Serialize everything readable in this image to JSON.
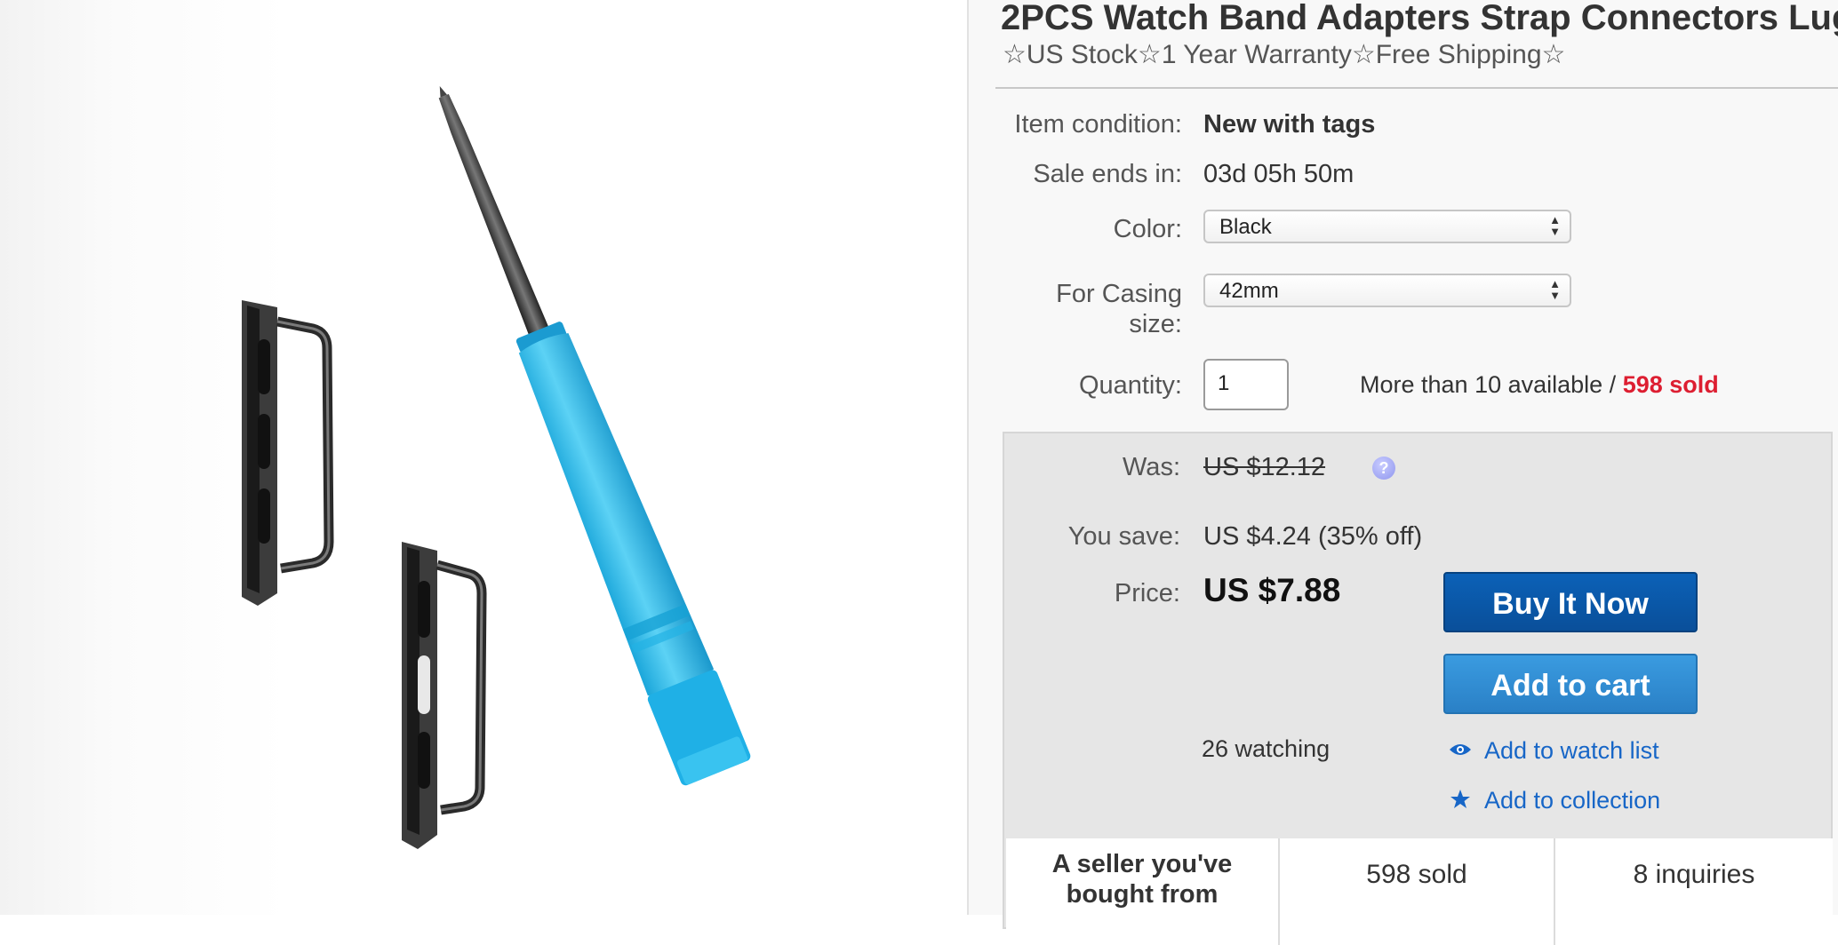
{
  "product": {
    "title": "2PCS Watch Band Adapters Strap Connectors Lug",
    "subtitle": "☆US Stock☆1 Year Warranty☆Free Shipping☆"
  },
  "details": {
    "condition_label": "Item condition:",
    "condition_value": "New with tags",
    "sale_label": "Sale ends in:",
    "sale_value": "03d 05h 50m",
    "color_label": "Color:",
    "color_value": "Black",
    "casing_label_1": "For Casing",
    "casing_label_2": "size:",
    "casing_value": "42mm",
    "quantity_label": "Quantity:",
    "quantity_value": "1",
    "availability": "More than 10 available / ",
    "sold": "598 sold"
  },
  "pricing": {
    "was_label": "Was:",
    "was_value": "US $12.12",
    "help_icon": "?",
    "save_label": "You save:",
    "save_value": "US $4.24 (35% off)",
    "price_label": "Price:",
    "price_value": "US $7.88",
    "buy_button": "Buy It Now",
    "cart_button": "Add to cart",
    "watching": "26 watching",
    "watch_link": "Add to watch list",
    "collection_link": "Add to collection"
  },
  "stats": {
    "seller_line1": "A seller you've",
    "seller_line2": "bought from",
    "sold": "598 sold",
    "inquiries": "8 inquiries"
  },
  "icons": {
    "help": "help-icon",
    "watch": "eye-icon",
    "collection": "star-icon"
  },
  "colors": {
    "accent_red": "#dd1e31",
    "buy_button": "#0b61b7",
    "cart_button": "#3a9be0",
    "link": "#1766c7"
  }
}
